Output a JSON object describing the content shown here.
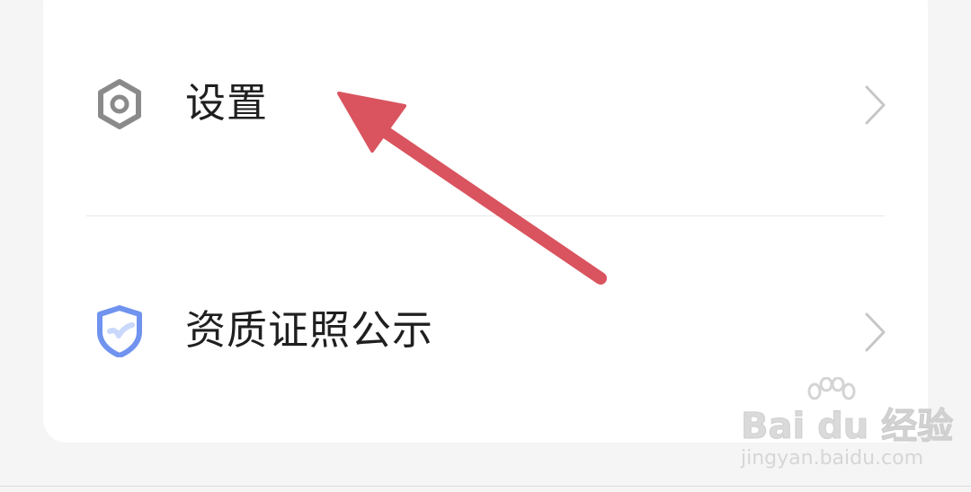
{
  "menu": {
    "items": [
      {
        "label": "设置",
        "icon": "hexagon-settings-icon"
      },
      {
        "label": "资质证照公示",
        "icon": "shield-check-icon"
      }
    ]
  },
  "watermark": {
    "brand": "Bai du 经验",
    "domain": "jingyan.baidu.com"
  },
  "colors": {
    "annotation_arrow": "#d9545e",
    "shield_icon": "#6f93ee",
    "settings_icon": "#8a8a8a",
    "chevron": "#c7c7c7"
  }
}
